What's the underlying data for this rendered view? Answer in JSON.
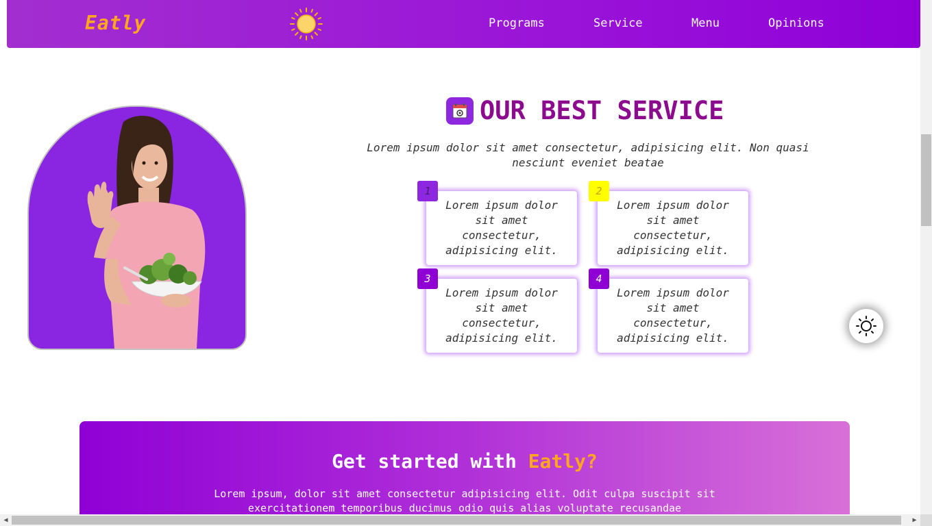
{
  "navbar": {
    "logo": "Eatly",
    "links": [
      "Programs",
      "Service",
      "Menu",
      "Opinions"
    ]
  },
  "service": {
    "title": "OUR BEST SERVICE",
    "description": "Lorem ipsum dolor sit amet consectetur, adipisicing elit. Non quasi nesciunt eveniet beatae",
    "cards": [
      {
        "number": "1",
        "text": "Lorem ipsum dolor sit amet consectetur, adipisicing elit.",
        "badge_color": "#8e27e0"
      },
      {
        "number": "2",
        "text": "Lorem ipsum dolor sit amet consectetur, adipisicing elit.",
        "badge_color": "#ffff00"
      },
      {
        "number": "3",
        "text": "Lorem ipsum dolor sit amet consectetur, adipisicing elit.",
        "badge_color": "#8e00d4"
      },
      {
        "number": "4",
        "text": "Lorem ipsum dolor sit amet consectetur, adipisicing elit.",
        "badge_color": "#8e00d4"
      }
    ]
  },
  "cta": {
    "title_prefix": "Get started with ",
    "title_accent": "Eatly?",
    "text": "Lorem ipsum, dolor sit amet consectetur adipisicing elit. Odit culpa suscipit sit exercitationem temporibus ducimus odio quis alias voluptate recusandae"
  },
  "icons": {
    "nav_logo_icon": "sun-icon",
    "section_icon": "calendar-icon",
    "theme_toggle": "sun-outline-icon"
  },
  "colors": {
    "brand_purple": "#9a14d8",
    "accent_orange": "#ffa51f",
    "title_color": "#8b0a8e"
  }
}
